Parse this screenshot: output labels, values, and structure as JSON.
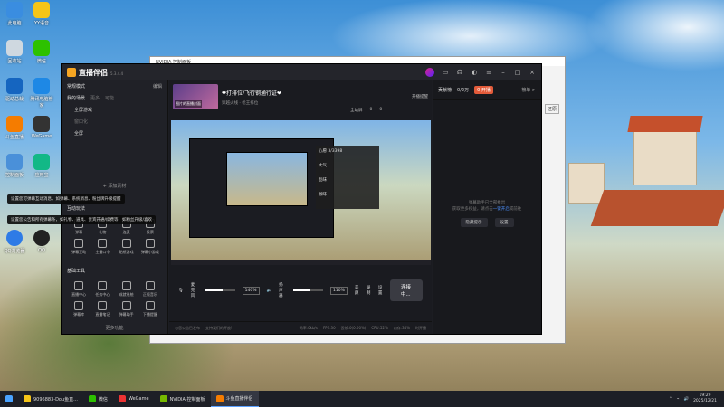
{
  "desktop": {
    "icons": [
      {
        "label": "此电脑"
      },
      {
        "label": "YY语音"
      },
      {
        "label": "回收站"
      },
      {
        "label": "微信"
      },
      {
        "label": "驱动总裁"
      },
      {
        "label": "腾讯电脑管家"
      },
      {
        "label": "斗鱼直播"
      },
      {
        "label": "WeGame"
      },
      {
        "label": "控制面板"
      },
      {
        "label": "应用宝"
      },
      {
        "label": "QQ浏览器"
      },
      {
        "label": "QQ"
      }
    ]
  },
  "bg_window": {
    "title": "NVIDIA 控制面板",
    "hint": "还原"
  },
  "app": {
    "name": "直播伴侣",
    "version": "5.3.4.4",
    "left": {
      "mode": "常规模式",
      "edit": "编辑",
      "cols": [
        "我的场景",
        "更多",
        "可能"
      ],
      "scenes": [
        "全屏游戏",
        "窗口化",
        "全屏"
      ],
      "add_material": "+ 添加素材",
      "interact_title": "互动玩法",
      "interact_items": [
        "弹幕",
        "礼物",
        "连麦",
        "投票",
        "弹幕互动",
        "主播口令",
        "贴纸游戏",
        "弹幕小游戏"
      ],
      "basic_title": "基础工具",
      "basic_items": [
        "直播中心",
        "任务中心",
        "成就系统",
        "正版音乐",
        "弹幕库",
        "直播笔记",
        "弹幕助手",
        "下播提醒"
      ],
      "more": "更多功能",
      "tooltip1": "设置您可弹幕互动消息，如弹幕、系统消息、粉丝牌升级提醒",
      "tooltip2": "设置您公告和所有弹幕条，如礼物、道具、贵宾开通/续费等，如粉丝升级/喜欢"
    },
    "center": {
      "thumb_label": "图片的直播封面",
      "room_title": "❤打排位/飞行钢通行证❤",
      "room_cat": "穿越火线 · 枪王排位",
      "ctrl1": "开播提醒",
      "ctrl2": "全站屏",
      "ctrl3": "0",
      "ctrl4": "0",
      "popup_title": "心愿 3/3398",
      "popup_items": [
        "大气",
        "品味",
        "咖啡"
      ],
      "mic_label": "麦克风",
      "mic_pct": "140%",
      "speaker_label": "扬声器",
      "speaker_pct": "110%",
      "effect_label": "美颜",
      "record_label": "录制",
      "settings_label": "设置",
      "start_btn": "连接中...",
      "status": [
        "与您公告已发布",
        "支持我们的开放!",
        "码率:0kb/s",
        "FPS:30",
        "丢帧:0(0.00%)",
        "CPU:52%",
        "内存:34%",
        "时开播"
      ]
    },
    "right": {
      "tab": "贡献榜",
      "count": "0/2万",
      "pill": "0 开播",
      "more": "榜单 >",
      "empty1": "弹幕助手已全部推出",
      "empty2": "获取更多权益，请点击",
      "empty_link": "一键开启",
      "empty3": "或前往",
      "btn1": "隐藏提示",
      "btn2": "设置"
    }
  },
  "taskbar": {
    "items": [
      "9096883-Dou鱼直...",
      "微信",
      "WeGame",
      "NVIDIA 控制面板",
      "斗鱼直播伴侣"
    ],
    "time": "19:29",
    "date": "2025/12/21"
  }
}
